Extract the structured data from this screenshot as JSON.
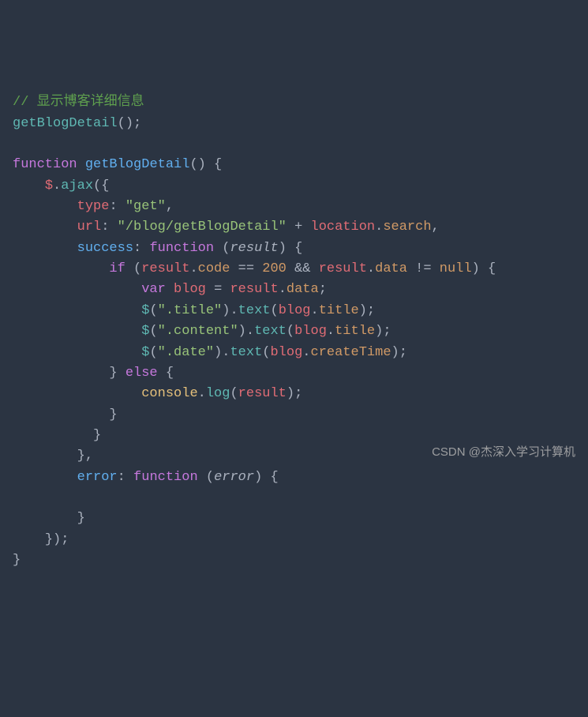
{
  "code": {
    "line1_comment": "// 显示博客详细信息",
    "line2_call": "getBlogDetail",
    "line2_paren": "();",
    "line4_kw_function": "function",
    "line4_funcname": "getBlogDetail",
    "line4_tail": "() {",
    "line5_dollar": "$",
    "line5_dot": ".",
    "line5_ajax": "ajax",
    "line5_tail": "({",
    "line6_key": "type",
    "line6_colon": ": ",
    "line6_val": "\"get\"",
    "line6_comma": ",",
    "line7_key": "url",
    "line7_colon": ": ",
    "line7_val": "\"/blog/getBlogDetail\"",
    "line7_plus": " + ",
    "line7_loc": "location",
    "line7_dot": ".",
    "line7_search": "search",
    "line7_comma": ",",
    "line8_key": "success",
    "line8_colon": ": ",
    "line8_kw": "function",
    "line8_paren_open": " (",
    "line8_param": "result",
    "line8_paren_close": ") {",
    "line9_if": "if",
    "line9_open": " (",
    "line9_result1": "result",
    "line9_dot1": ".",
    "line9_code": "code",
    "line9_eq": " == ",
    "line9_200": "200",
    "line9_and": " && ",
    "line9_result2": "result",
    "line9_dot2": ".",
    "line9_data": "data",
    "line9_neq": " != ",
    "line9_null": "null",
    "line9_close": ") {",
    "line10_var": "var",
    "line10_blog": " blog ",
    "line10_eq": "= ",
    "line10_result": "result",
    "line10_dot": ".",
    "line10_data": "data",
    "line10_semi": ";",
    "line11_dollar": "$",
    "line11_open": "(",
    "line11_sel": "\".title\"",
    "line11_mid": ").",
    "line11_text": "text",
    "line11_open2": "(",
    "line11_blog": "blog",
    "line11_dot": ".",
    "line11_title": "title",
    "line11_close": ");",
    "line12_dollar": "$",
    "line12_open": "(",
    "line12_sel": "\".content\"",
    "line12_mid": ").",
    "line12_text": "text",
    "line12_open2": "(",
    "line12_blog": "blog",
    "line12_dot": ".",
    "line12_title": "title",
    "line12_close": ");",
    "line13_dollar": "$",
    "line13_open": "(",
    "line13_sel": "\".date\"",
    "line13_mid": ").",
    "line13_text": "text",
    "line13_open2": "(",
    "line13_blog": "blog",
    "line13_dot": ".",
    "line13_ct": "createTime",
    "line13_close": ");",
    "line14_brace": "} ",
    "line14_else": "else",
    "line14_open": " {",
    "line15_console": "console",
    "line15_dot": ".",
    "line15_log": "log",
    "line15_open": "(",
    "line15_result": "result",
    "line15_close": ");",
    "line16_brace": "}",
    "line17_brace": "}",
    "line18_brace": "},",
    "line19_key": "error",
    "line19_colon": ": ",
    "line19_kw": "function",
    "line19_open": " (",
    "line19_param": "error",
    "line19_close": ") {",
    "line21_brace": "}",
    "line22_brace": "});",
    "line23_brace": "}"
  },
  "watermark": "CSDN @杰深入学习计算机"
}
